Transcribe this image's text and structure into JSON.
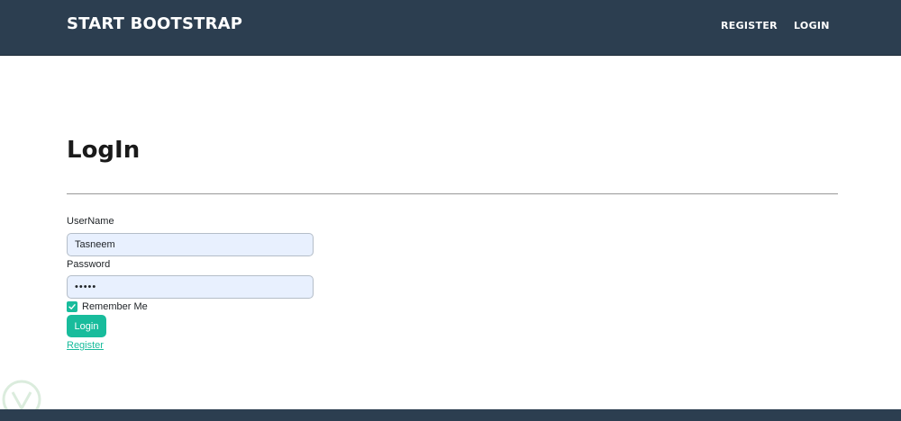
{
  "navbar": {
    "brand": "START BOOTSTRAP",
    "links": [
      {
        "label": "REGISTER"
      },
      {
        "label": "LOGIN"
      }
    ]
  },
  "page": {
    "title": "LogIn"
  },
  "form": {
    "username_label": "UserName",
    "username_value": "Tasneem",
    "password_label": "Password",
    "password_value": "•••••",
    "remember_label": "Remember Me",
    "remember_checked": true,
    "login_button": "Login",
    "register_link": "Register"
  },
  "colors": {
    "navbar_bg": "#2c3e50",
    "accent": "#18bc9c",
    "input_bg": "#e8f0fe"
  }
}
